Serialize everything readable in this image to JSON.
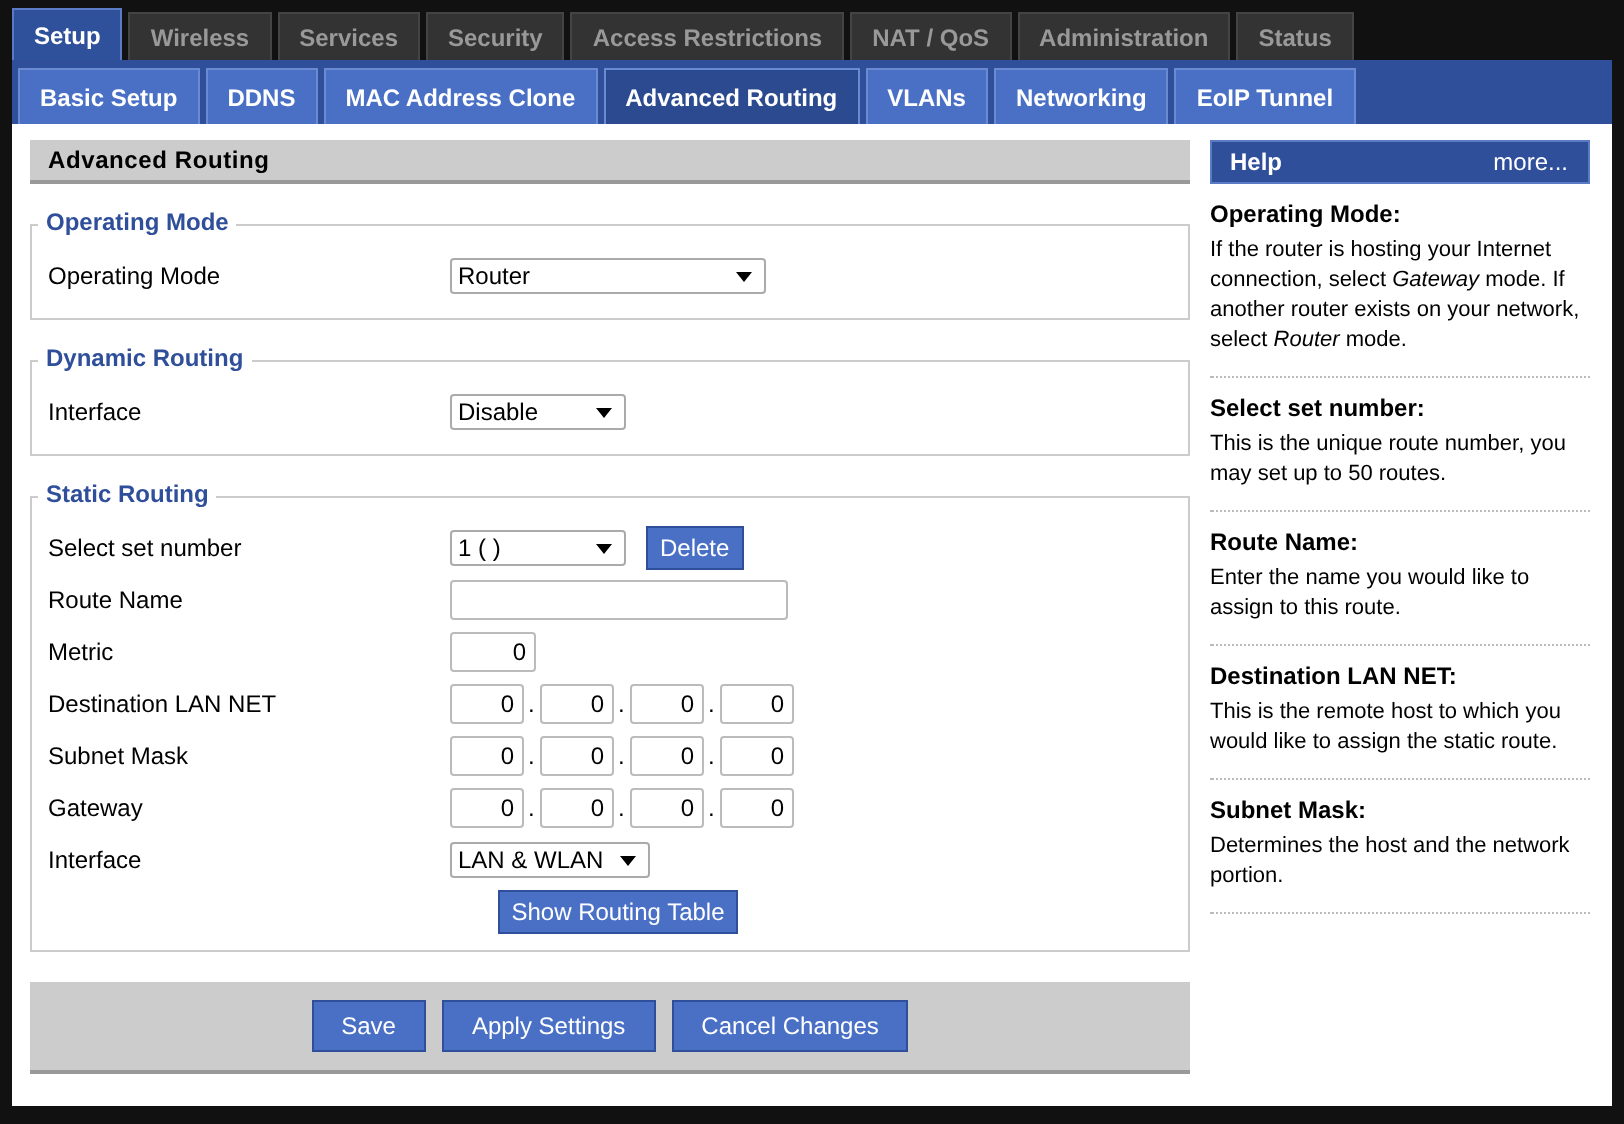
{
  "tabs": [
    {
      "label": "Setup",
      "selected": true
    },
    {
      "label": "Wireless",
      "selected": false
    },
    {
      "label": "Services",
      "selected": false
    },
    {
      "label": "Security",
      "selected": false
    },
    {
      "label": "Access Restrictions",
      "selected": false
    },
    {
      "label": "NAT / QoS",
      "selected": false
    },
    {
      "label": "Administration",
      "selected": false
    },
    {
      "label": "Status",
      "selected": false
    }
  ],
  "subtabs": [
    {
      "label": "Basic Setup",
      "selected": false
    },
    {
      "label": "DDNS",
      "selected": false
    },
    {
      "label": "MAC Address Clone",
      "selected": false
    },
    {
      "label": "Advanced Routing",
      "selected": true
    },
    {
      "label": "VLANs",
      "selected": false
    },
    {
      "label": "Networking",
      "selected": false
    },
    {
      "label": "EoIP Tunnel",
      "selected": false
    }
  ],
  "panel_title": "Advanced Routing",
  "sections": [
    {
      "title": "Operating Mode",
      "rows": [
        {
          "label": "Operating Mode",
          "kind": "select",
          "value": "Router"
        }
      ]
    },
    {
      "title": "Dynamic Routing",
      "rows": [
        {
          "label": "Interface",
          "kind": "select",
          "value": "Disable"
        }
      ]
    },
    {
      "title": "Static Routing",
      "rows": [
        {
          "label": "Select set number",
          "kind": "select",
          "value": "1 ( )",
          "button": "Delete"
        },
        {
          "label": "Route Name",
          "kind": "text"
        },
        {
          "label": "Metric",
          "kind": "number",
          "value": "0"
        },
        {
          "label": "Destination LAN NET",
          "kind": "ip",
          "octets": [
            "0",
            "0",
            "0",
            "0"
          ],
          "separators": [
            ".",
            ".",
            "."
          ]
        },
        {
          "label": "Subnet Mask",
          "kind": "ip",
          "octets": [
            "0",
            "0",
            "0",
            "0"
          ],
          "separators": [
            ".",
            ".",
            "."
          ]
        },
        {
          "label": "Gateway",
          "kind": "ip",
          "octets": [
            "0",
            "0",
            "0",
            "0"
          ],
          "separators": [
            ".",
            ".",
            "."
          ]
        },
        {
          "label": "Interface",
          "kind": "select",
          "value": "LAN & WLAN"
        }
      ],
      "button": "Show Routing Table"
    }
  ],
  "footer_buttons": [
    "Save",
    "Apply Settings",
    "Cancel Changes"
  ],
  "help": {
    "title": "Help",
    "more": "more...",
    "items": [
      {
        "heading": "Operating Mode:",
        "text": "If the router is hosting your Internet connection, select *Gateway* mode. If another router exists on your network, select *Router* mode."
      },
      {
        "heading": "Select set number:",
        "text": "This is the unique route number, you may set up to 50 routes."
      },
      {
        "heading": "Route Name:",
        "text": "Enter the name you would like to assign to this route."
      },
      {
        "heading": "Destination LAN NET:",
        "text": "This is the remote host to which you would like to assign the static route."
      },
      {
        "heading": "Subnet Mask:",
        "text": "Determines the host and the network portion."
      }
    ]
  }
}
